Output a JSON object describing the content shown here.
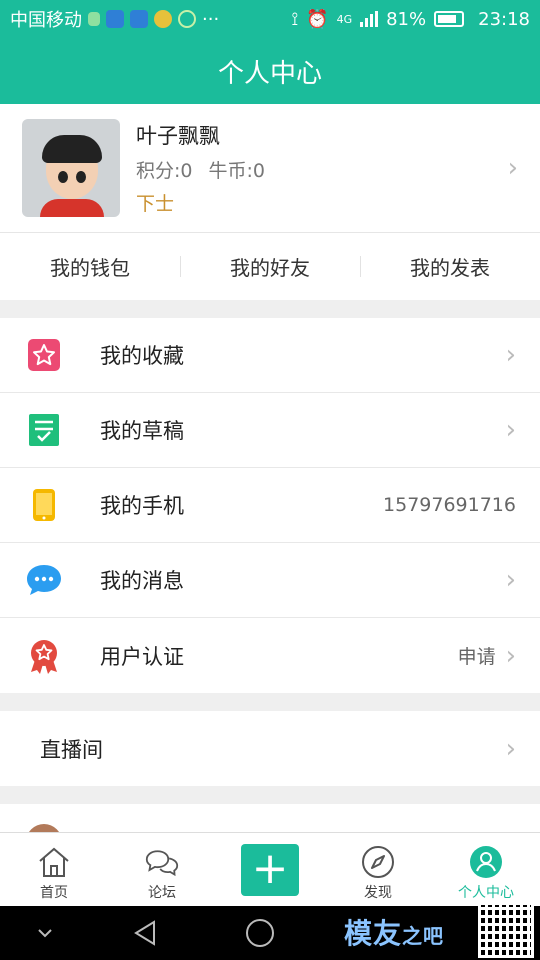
{
  "status_bar": {
    "carrier": "中国移动",
    "dots": "···",
    "network": "4G",
    "battery_pct": "81%",
    "time": "23:18"
  },
  "header": {
    "title": "个人中心"
  },
  "profile": {
    "name": "叶子飘飘",
    "points": "积分:0",
    "coins": "牛币:0",
    "rank": "下士"
  },
  "quick_links": [
    "我的钱包",
    "我的好友",
    "我的发表"
  ],
  "menu_group_1": [
    {
      "label": "我的收藏",
      "icon": "star-icon",
      "color": "#ec4a73",
      "value": ""
    },
    {
      "label": "我的草稿",
      "icon": "draft-icon",
      "color": "#1fbf7c",
      "value": ""
    },
    {
      "label": "我的手机",
      "icon": "phone-icon",
      "color": "#f5b800",
      "value": "15797691716"
    },
    {
      "label": "我的消息",
      "icon": "message-icon",
      "color": "#2b9df0",
      "value": ""
    },
    {
      "label": "用户认证",
      "icon": "badge-icon",
      "color": "#e24a3f",
      "value": "申请"
    }
  ],
  "menu_group_2": [
    {
      "label": "直播间"
    }
  ],
  "tab_bar": {
    "home": "首页",
    "forum": "论坛",
    "post": "+",
    "discover": "发现",
    "profile": "个人中心"
  },
  "watermark": {
    "text_main": "模友",
    "text_accent": "之吧"
  },
  "colors": {
    "accent": "#1bbc9b",
    "rank": "#c9902e"
  }
}
